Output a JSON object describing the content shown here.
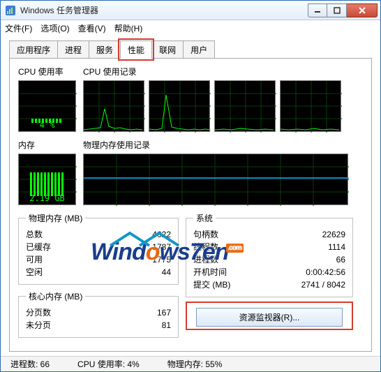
{
  "window": {
    "title": "Windows 任务管理器"
  },
  "menu": {
    "file": "文件(F)",
    "options": "选项(O)",
    "view": "查看(V)",
    "help": "帮助(H)"
  },
  "tabs": {
    "apps": "应用程序",
    "processes": "进程",
    "services": "服务",
    "performance": "性能",
    "networking": "联网",
    "users": "用户"
  },
  "panel": {
    "cpu_usage_label": "CPU 使用率",
    "cpu_history_label": "CPU 使用记录",
    "mem_label": "内存",
    "mem_history_label": "物理内存使用记录",
    "cpu_pct": "4 %",
    "mem_val": "2.19 GB"
  },
  "phys_mem": {
    "legend": "物理内存 (MB)",
    "total_k": "总数",
    "total_v": "4022",
    "cached_k": "已缓存",
    "cached_v": "1787",
    "avail_k": "可用",
    "avail_v": "1775",
    "free_k": "空闲",
    "free_v": "44"
  },
  "kernel_mem": {
    "legend": "核心内存 (MB)",
    "paged_k": "分页数",
    "paged_v": "167",
    "nonpaged_k": "未分页",
    "nonpaged_v": "81"
  },
  "system": {
    "legend": "系统",
    "handles_k": "句柄数",
    "handles_v": "22629",
    "threads_k": "线程数",
    "threads_v": "1114",
    "procs_k": "进程数",
    "procs_v": "66",
    "uptime_k": "开机时间",
    "uptime_v": "0:00:42:56",
    "commit_k": "提交 (MB)",
    "commit_v": "2741 / 8042"
  },
  "res_btn": "资源监视器(R)...",
  "status": {
    "procs": "进程数: 66",
    "cpu": "CPU 使用率: 4%",
    "mem": "物理内存: 55%"
  },
  "watermark": {
    "brand_a": "Wind",
    "brand_o": "o",
    "brand_b": "ws7en",
    "tag": ".com"
  },
  "chart_data": {
    "cpu_gauge": {
      "type": "bar",
      "value": 4,
      "ylim": [
        0,
        100
      ],
      "title": "CPU 使用率"
    },
    "mem_gauge": {
      "type": "bar",
      "value_gb": 2.19,
      "total_gb": 4.0,
      "title": "内存"
    },
    "cpu_history": {
      "type": "line",
      "cores": 4,
      "ylim": [
        0,
        100
      ],
      "series": [
        {
          "name": "core0",
          "values": [
            2,
            3,
            4,
            5,
            35,
            8,
            5,
            6,
            4,
            3,
            2,
            3,
            4,
            3,
            2
          ]
        },
        {
          "name": "core1",
          "values": [
            3,
            2,
            4,
            60,
            6,
            4,
            5,
            3,
            4,
            2,
            3,
            4,
            2,
            3,
            2
          ]
        },
        {
          "name": "core2",
          "values": [
            2,
            3,
            2,
            3,
            4,
            5,
            4,
            3,
            2,
            3,
            2,
            3,
            4,
            2,
            3
          ]
        },
        {
          "name": "core3",
          "values": [
            3,
            2,
            3,
            2,
            4,
            3,
            5,
            2,
            4,
            3,
            2,
            3,
            2,
            4,
            3
          ]
        }
      ]
    },
    "mem_history": {
      "type": "line",
      "ylim_gb": [
        0,
        4
      ],
      "values_gb": [
        2.18,
        2.18,
        2.19,
        2.19,
        2.19,
        2.19,
        2.19,
        2.19,
        2.19,
        2.19,
        2.19,
        2.19
      ]
    }
  }
}
